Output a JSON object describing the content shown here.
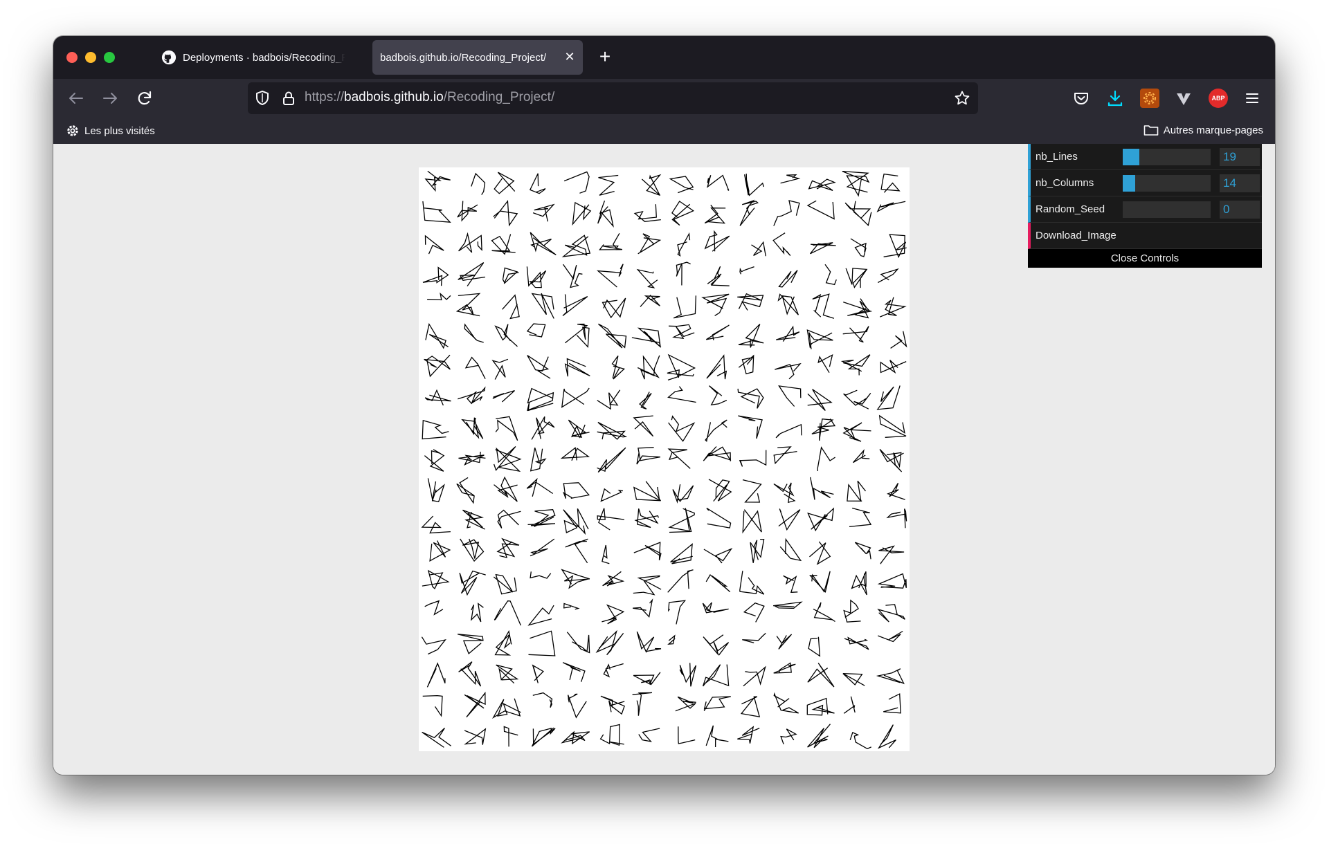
{
  "browser": {
    "tabs": [
      {
        "title": "Deployments · badbois/Recoding_Project",
        "active": false
      },
      {
        "title": "badbois.github.io/Recoding_Project/",
        "active": true
      }
    ],
    "url": {
      "scheme": "https://",
      "host": "badbois.github.io",
      "path": "/Recoding_Project/"
    },
    "bookmarks": {
      "left": "Les plus visités",
      "right": "Autres marque-pages"
    },
    "toolbar_icons": [
      "pocket-icon",
      "download-icon",
      "extension-icon",
      "vivaldi-icon",
      "adblock-icon",
      "menu-icon"
    ],
    "adblock_label": "ABP"
  },
  "colors": {
    "accent": "#2fa1d6",
    "function_accent": "#e61d5f",
    "download": "#0df"
  },
  "controls": {
    "nb_lines": {
      "label": "nb_Lines",
      "value": "19"
    },
    "nb_columns": {
      "label": "nb_Columns",
      "value": "14"
    },
    "random_seed": {
      "label": "Random_Seed",
      "value": "0"
    },
    "download": {
      "label": "Download_Image"
    },
    "close": "Close Controls"
  },
  "artwork": {
    "rows": 19,
    "columns": 14,
    "seed": 0,
    "nb_lines_fill": 0.19,
    "nb_columns_fill": 0.14,
    "random_seed_fill": 0
  }
}
